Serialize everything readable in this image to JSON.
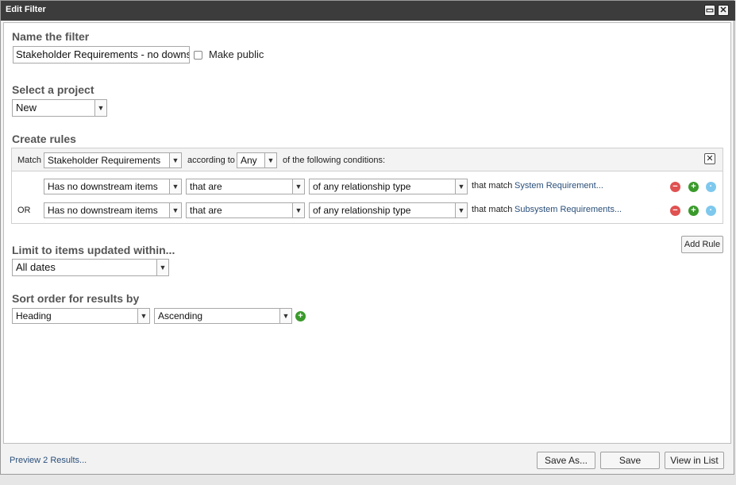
{
  "window": {
    "title": "Edit Filter",
    "minimize_icon": "minimize-icon",
    "close_icon": "close-icon"
  },
  "name_section": {
    "label": "Name the filter",
    "value": "Stakeholder Requirements - no downstream",
    "make_public_label": "Make public"
  },
  "project_section": {
    "label": "Select a project",
    "selected": "New"
  },
  "rules_section": {
    "label": "Create rules",
    "match_label": "Match",
    "match_value": "Stakeholder Requirements",
    "according_to_label": "according to",
    "according_value": "Any",
    "conditions_label": "of the following conditions:",
    "rules": [
      {
        "prefix": "",
        "condition": "Has no downstream items",
        "qualifier": "that are",
        "relationship": "of any relationship type",
        "that_match_label": "that match",
        "target": "System Requirement..."
      },
      {
        "prefix": "OR",
        "condition": "Has no downstream items",
        "qualifier": "that are",
        "relationship": "of any relationship type",
        "that_match_label": "that match",
        "target": "Subsystem Requirements..."
      }
    ],
    "add_rule_label": "Add Rule"
  },
  "limit_section": {
    "label": "Limit to items updated within...",
    "selected": "All dates"
  },
  "sort_section": {
    "label": "Sort order for results by",
    "field": "Heading",
    "order": "Ascending"
  },
  "footer": {
    "preview_link": "Preview 2 Results...",
    "save_as_label": "Save As...",
    "save_label": "Save",
    "view_in_list_label": "View in List"
  }
}
